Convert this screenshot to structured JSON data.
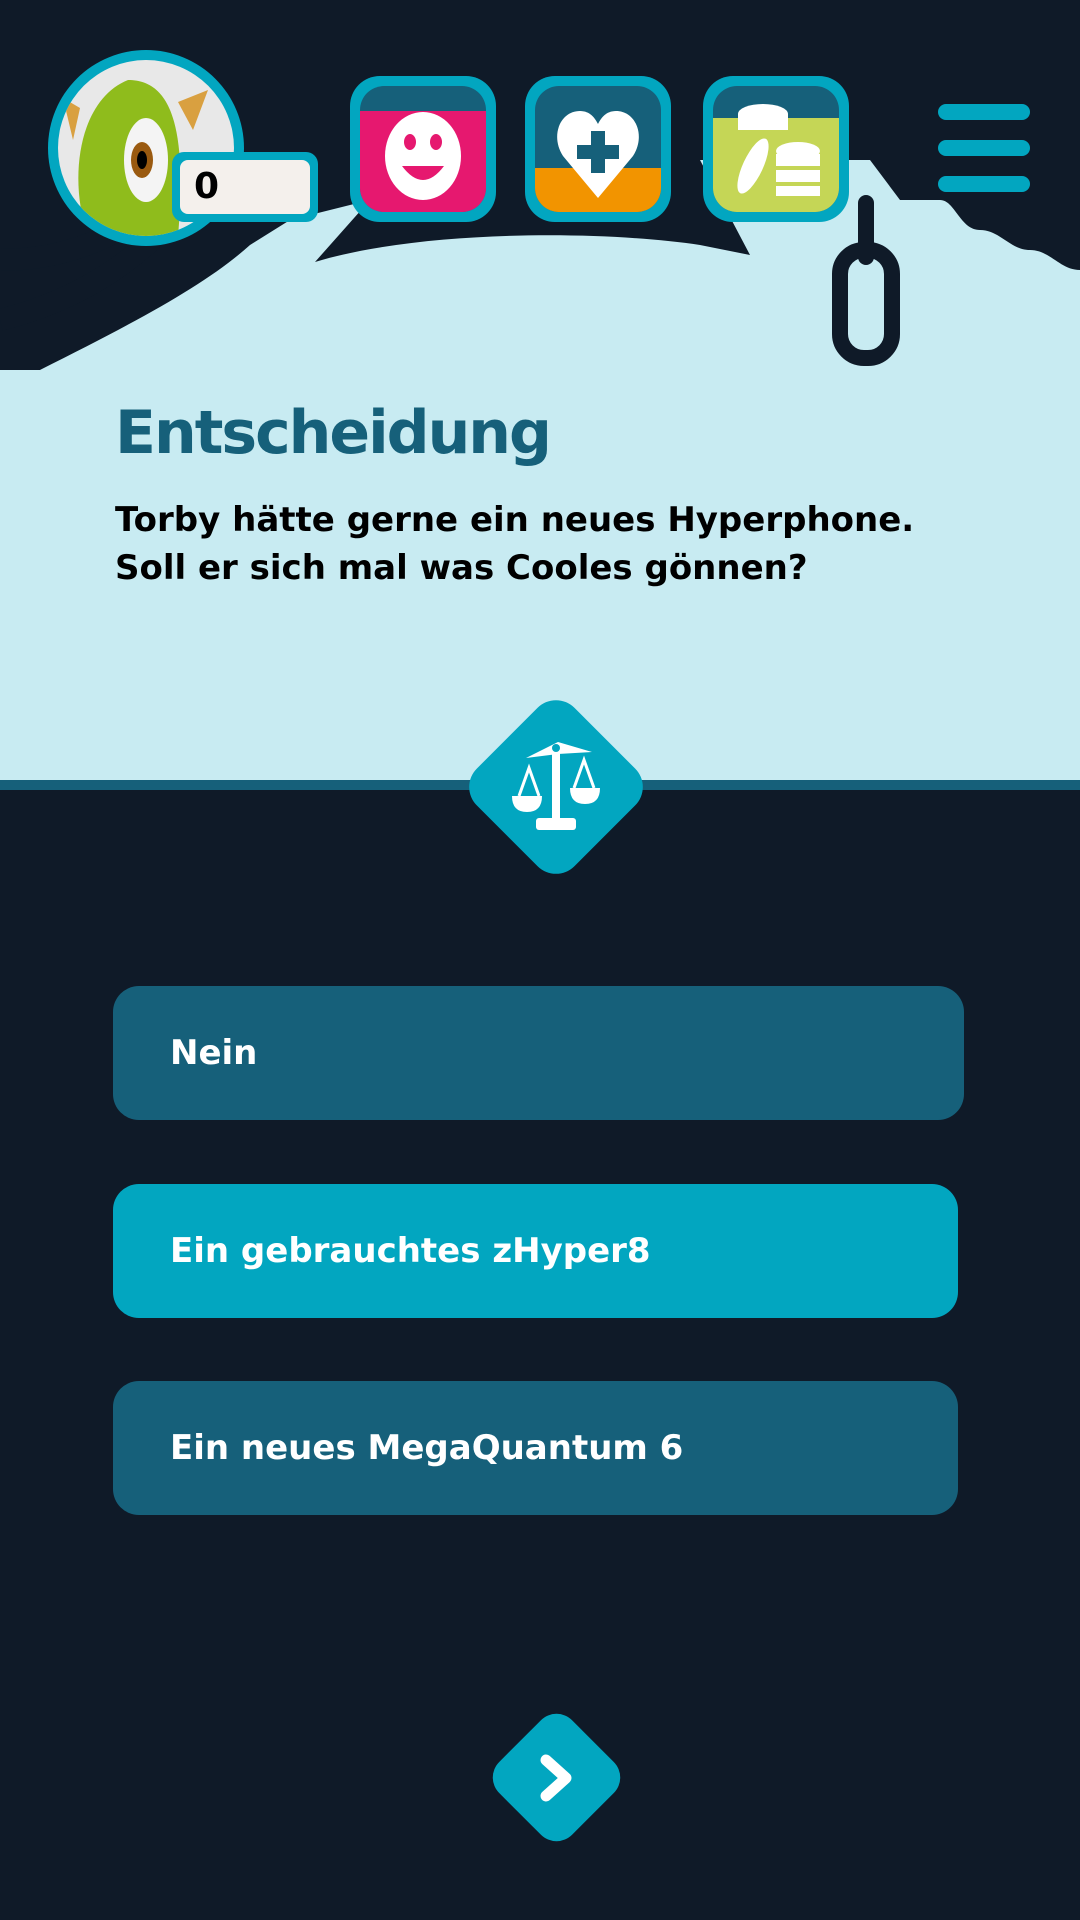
{
  "header": {
    "score": "0",
    "stats": [
      {
        "name": "happiness",
        "icon": "smiley-icon",
        "fill_color": "#e6186f",
        "level": 0.8
      },
      {
        "name": "health",
        "icon": "heart-plus-icon",
        "fill_color": "#f29400",
        "level": 0.35
      },
      {
        "name": "money",
        "icon": "coins-icon",
        "fill_color": "#c5d656",
        "level": 0.75
      }
    ],
    "menu_icon": "hamburger-menu-icon"
  },
  "decision": {
    "title": "Entscheidung",
    "question": "Torby hätte gerne ein neues Hyperphone. Soll er sich mal was Cooles gönnen?",
    "icon": "scales-icon"
  },
  "answers": [
    {
      "label": "Nein",
      "selected": false
    },
    {
      "label": "Ein gebrauchtes zHyper8",
      "selected": true
    },
    {
      "label": "Ein neues MegaQuantum 6",
      "selected": false
    }
  ],
  "next_icon": "chevron-right-icon",
  "colors": {
    "background": "#0f1a28",
    "panel": "#c8ebf2",
    "accent": "#02a6c0",
    "button": "#16607a"
  }
}
